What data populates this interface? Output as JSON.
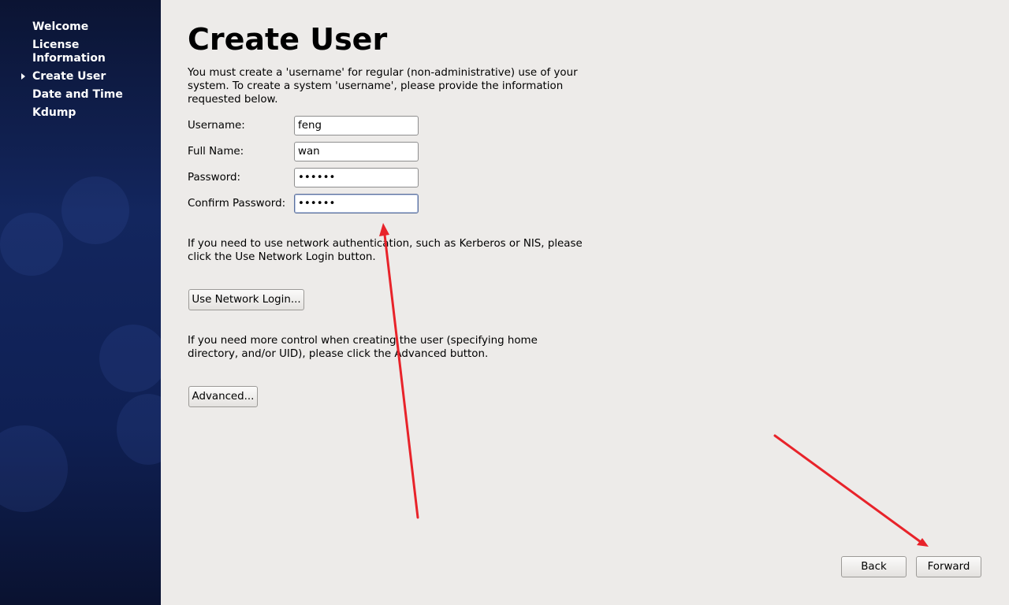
{
  "sidebar": {
    "items": [
      {
        "label": "Welcome",
        "active": false
      },
      {
        "label": "License Information",
        "active": false
      },
      {
        "label": "Create User",
        "active": true
      },
      {
        "label": "Date and Time",
        "active": false
      },
      {
        "label": "Kdump",
        "active": false
      }
    ]
  },
  "page": {
    "title": "Create User",
    "intro": "You must create a 'username' for regular (non-administrative) use of your system.  To create a system 'username', please provide the information requested below."
  },
  "form": {
    "username": {
      "label": "Username:",
      "value": "feng"
    },
    "fullname": {
      "label": "Full Name:",
      "value": "wan"
    },
    "password": {
      "label": "Password:",
      "value": "••••••"
    },
    "confirm_password": {
      "label": "Confirm Password:",
      "value": "••••••"
    }
  },
  "network": {
    "text": "If you need to use network authentication, such as Kerberos or NIS, please click the Use Network Login button.",
    "button_label": "Use Network Login..."
  },
  "advanced": {
    "text": "If you need more control when creating the user (specifying home directory, and/or UID), please click the Advanced button.",
    "button_label": "Advanced..."
  },
  "footer": {
    "back_label": "Back",
    "forward_label": "Forward"
  },
  "colors": {
    "annotation_arrow": "#e8232a",
    "sidebar_bg": "#13265e",
    "content_bg": "#edebe9"
  },
  "icons": {
    "active_indicator": "triangle-right-icon"
  }
}
